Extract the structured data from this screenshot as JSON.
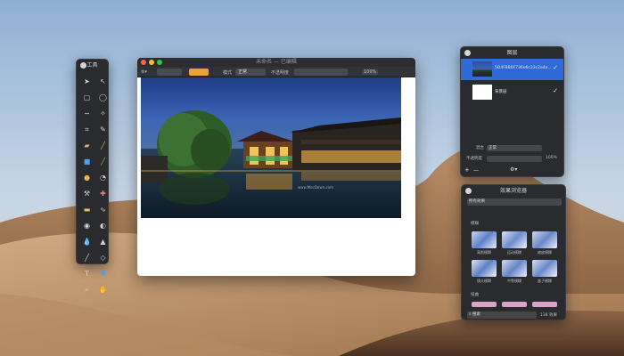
{
  "colors": {
    "accent_blue": "#2f6ad8",
    "accent_orange": "#e8a33a",
    "panel_bg": "#2a2b2e"
  },
  "tools_panel": {
    "title": "工具",
    "tools": [
      "pointer-icon",
      "select-icon",
      "rect-select-icon",
      "ellipse-select-icon",
      "lasso-icon",
      "magic-wand-icon",
      "crop-icon",
      "pen-icon",
      "eraser-icon",
      "brush-icon",
      "color-fill-icon",
      "gradient-icon",
      "smudge-icon",
      "color-picker-icon",
      "stamp-icon",
      "heal-icon",
      "sharpen-icon",
      "blur-icon",
      "eye-icon",
      "dodge-icon",
      "drop-icon",
      "triangle-icon",
      "line-icon",
      "shape-icon",
      "text-icon",
      "heart-icon",
      "zoom-icon",
      "hand-icon"
    ]
  },
  "main_window": {
    "title": "未命名 — 已编辑",
    "toolbar": {
      "mode_label": "模式",
      "mode_value": "正常",
      "opacity_label": "不透明度",
      "opacity_value": "100%"
    },
    "watermark": "www.MacDown.com"
  },
  "layers_panel": {
    "title": "图层",
    "layers": [
      {
        "name": "5D4F8B0F736e6c33c2a4a...",
        "visible": "✓",
        "selected": true
      },
      {
        "name": "背景层",
        "visible": "✓",
        "selected": false
      }
    ],
    "blend_label": "混合",
    "blend_value": "正常",
    "opacity_label": "不透明度",
    "opacity_value": "100%",
    "add": "+",
    "remove": "—"
  },
  "effects_panel": {
    "title": "效果浏览器",
    "category_value": "所有效果",
    "group1": "模糊",
    "row1": [
      "高斯模糊",
      "运动模糊",
      "缩放模糊"
    ],
    "row2": [
      "镜头模糊",
      "中等模糊",
      "盒子模糊"
    ],
    "group2": "扭曲",
    "search_placeholder": "搜索",
    "count": "138 效果"
  }
}
